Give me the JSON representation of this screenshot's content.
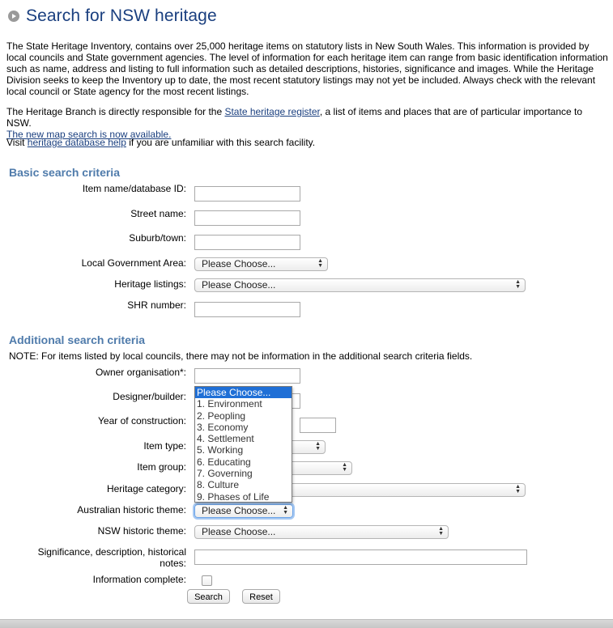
{
  "page": {
    "title": "Search for NSW heritage"
  },
  "intro": {
    "paragraph1": "The State Heritage Inventory, contains over 25,000 heritage items on statutory lists in New South Wales. This information is provided by local councils and State government agencies. The level of information for each heritage item can range from basic identification information such as name, address and listing to full information such as detailed descriptions, histories, significance and images. While the Heritage Division seeks to keep the Inventory up to date, the most recent statutory listings may not yet be included. Always check with the relevant local council or State agency for the most recent listings.",
    "paragraph2_before": "The Heritage Branch is directly responsible for the ",
    "paragraph2_link": "State heritage register",
    "paragraph2_after": ", a list of items and places that are of particular importance to NSW.",
    "map_link": "The new map search is now available.",
    "help_before": "Visit ",
    "help_link": "heritage database help",
    "help_after": " if you are unfamiliar with this search facility."
  },
  "basic": {
    "heading": "Basic search criteria",
    "item_name_label": "Item name/database ID:",
    "item_name_value": "",
    "street_label": "Street name:",
    "street_value": "",
    "suburb_label": "Suburb/town:",
    "suburb_value": "",
    "lga_label": "Local Government Area:",
    "lga_value": "Please Choose...",
    "listings_label": "Heritage listings:",
    "listings_value": "Please Choose...",
    "shr_label": "SHR number:",
    "shr_value": ""
  },
  "additional": {
    "heading": "Additional search criteria",
    "note": "NOTE: For items listed by local councils, there may not be information in the additional search criteria fields.",
    "owner_label": "Owner organisation*:",
    "owner_value": "",
    "designer_label": "Designer/builder:",
    "designer_value": "",
    "year_label": "Year of construction:",
    "year_value": "",
    "item_type_label": "Item type:",
    "item_group_label": "Item group:",
    "category_label": "Heritage category:",
    "aus_theme_label": "Australian historic theme:",
    "aus_theme_value": "Please Choose...",
    "nsw_theme_label": "NSW historic theme:",
    "nsw_theme_value": "Please Choose...",
    "significance_label": "Significance, description, historical notes:",
    "significance_value": "",
    "complete_label": "Information complete:"
  },
  "dropdown": {
    "options": [
      "Please Choose...",
      "1. Environment",
      "2. Peopling",
      "3. Economy",
      "4. Settlement",
      "5. Working",
      "6. Educating",
      "7. Governing",
      "8. Culture",
      "9. Phases of Life"
    ],
    "selected_index": 0
  },
  "buttons": {
    "search": "Search",
    "reset": "Reset"
  },
  "colors": {
    "title": "#1a3f7f",
    "heading": "#4f7bab",
    "link": "#1a3f7f",
    "selected_option": "#1f6fd6"
  }
}
